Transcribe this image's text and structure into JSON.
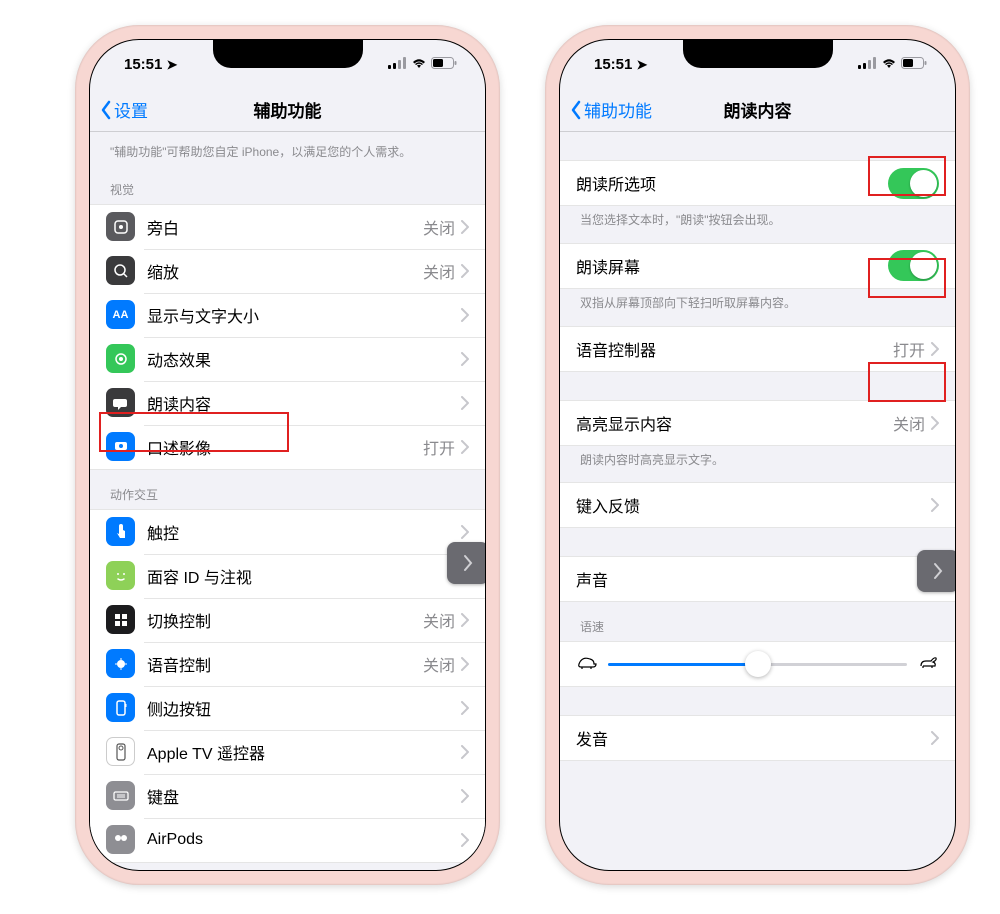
{
  "status": {
    "time": "15:51",
    "loc_icon": "➤"
  },
  "left": {
    "back": "设置",
    "title": "辅助功能",
    "intro": "\"辅助功能\"可帮助您自定 iPhone，以满足您的个人需求。",
    "sec_vision": "视觉",
    "items_vision": [
      {
        "label": "旁白",
        "value": "关闭"
      },
      {
        "label": "缩放",
        "value": "关闭"
      },
      {
        "label": "显示与文字大小",
        "value": ""
      },
      {
        "label": "动态效果",
        "value": ""
      },
      {
        "label": "朗读内容",
        "value": ""
      },
      {
        "label": "口述影像",
        "value": "打开"
      }
    ],
    "sec_motor": "动作交互",
    "items_motor": [
      {
        "label": "触控",
        "value": ""
      },
      {
        "label": "面容 ID 与注视",
        "value": ""
      },
      {
        "label": "切换控制",
        "value": "关闭"
      },
      {
        "label": "语音控制",
        "value": "关闭"
      },
      {
        "label": "侧边按钮",
        "value": ""
      },
      {
        "label": "Apple TV 遥控器",
        "value": ""
      },
      {
        "label": "键盘",
        "value": ""
      },
      {
        "label": "AirPods",
        "value": ""
      }
    ]
  },
  "right": {
    "back": "辅助功能",
    "title": "朗读内容",
    "r1_label": "朗读所选项",
    "r1_desc": "当您选择文本时，\"朗读\"按钮会出现。",
    "r2_label": "朗读屏幕",
    "r2_desc": "双指从屏幕顶部向下轻扫听取屏幕内容。",
    "r3_label": "语音控制器",
    "r3_value": "打开",
    "r4_label": "高亮显示内容",
    "r4_value": "关闭",
    "r4_desc": "朗读内容时高亮显示文字。",
    "r5_label": "键入反馈",
    "r6_label": "声音",
    "sec_speed": "语速",
    "r7_label": "发音"
  }
}
